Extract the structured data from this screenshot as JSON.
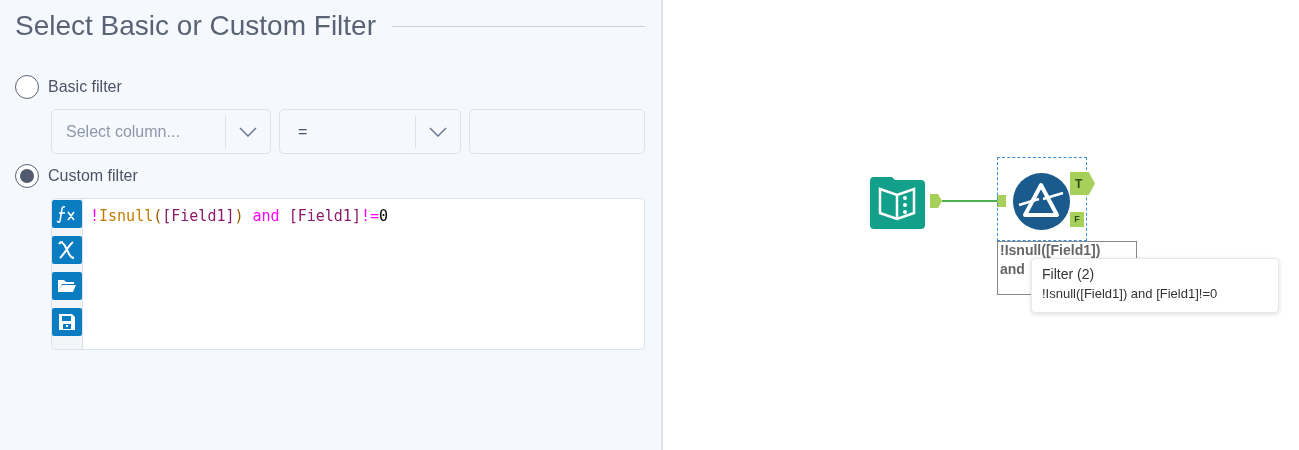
{
  "panel": {
    "title": "Select Basic or Custom Filter",
    "options": [
      {
        "label": "Basic filter",
        "selected": false
      },
      {
        "label": "Custom filter",
        "selected": true
      }
    ],
    "basic": {
      "column_placeholder": "Select column...",
      "operator": "="
    },
    "custom": {
      "tokens": [
        {
          "text": "!",
          "kind": "operator"
        },
        {
          "text": "Isnull",
          "kind": "function"
        },
        {
          "text": "(",
          "kind": "paren"
        },
        {
          "text": "[Field1]",
          "kind": "field"
        },
        {
          "text": ")",
          "kind": "paren"
        },
        {
          "text": " and ",
          "kind": "operator"
        },
        {
          "text": "[Field1]",
          "kind": "field"
        },
        {
          "text": "!=",
          "kind": "operator"
        },
        {
          "text": "0",
          "kind": "number"
        }
      ],
      "tools": [
        {
          "kind": "function"
        },
        {
          "kind": "variable"
        },
        {
          "kind": "open"
        },
        {
          "kind": "save"
        }
      ]
    }
  },
  "canvas": {
    "filter_node": {
      "true_anchor": "T",
      "false_anchor": "F",
      "annotation": [
        "!Isnull([Field1])",
        "and"
      ]
    },
    "tooltip": {
      "title": "Filter (2)",
      "text": "!Isnull([Field1]) and [Field1]!=0"
    }
  }
}
